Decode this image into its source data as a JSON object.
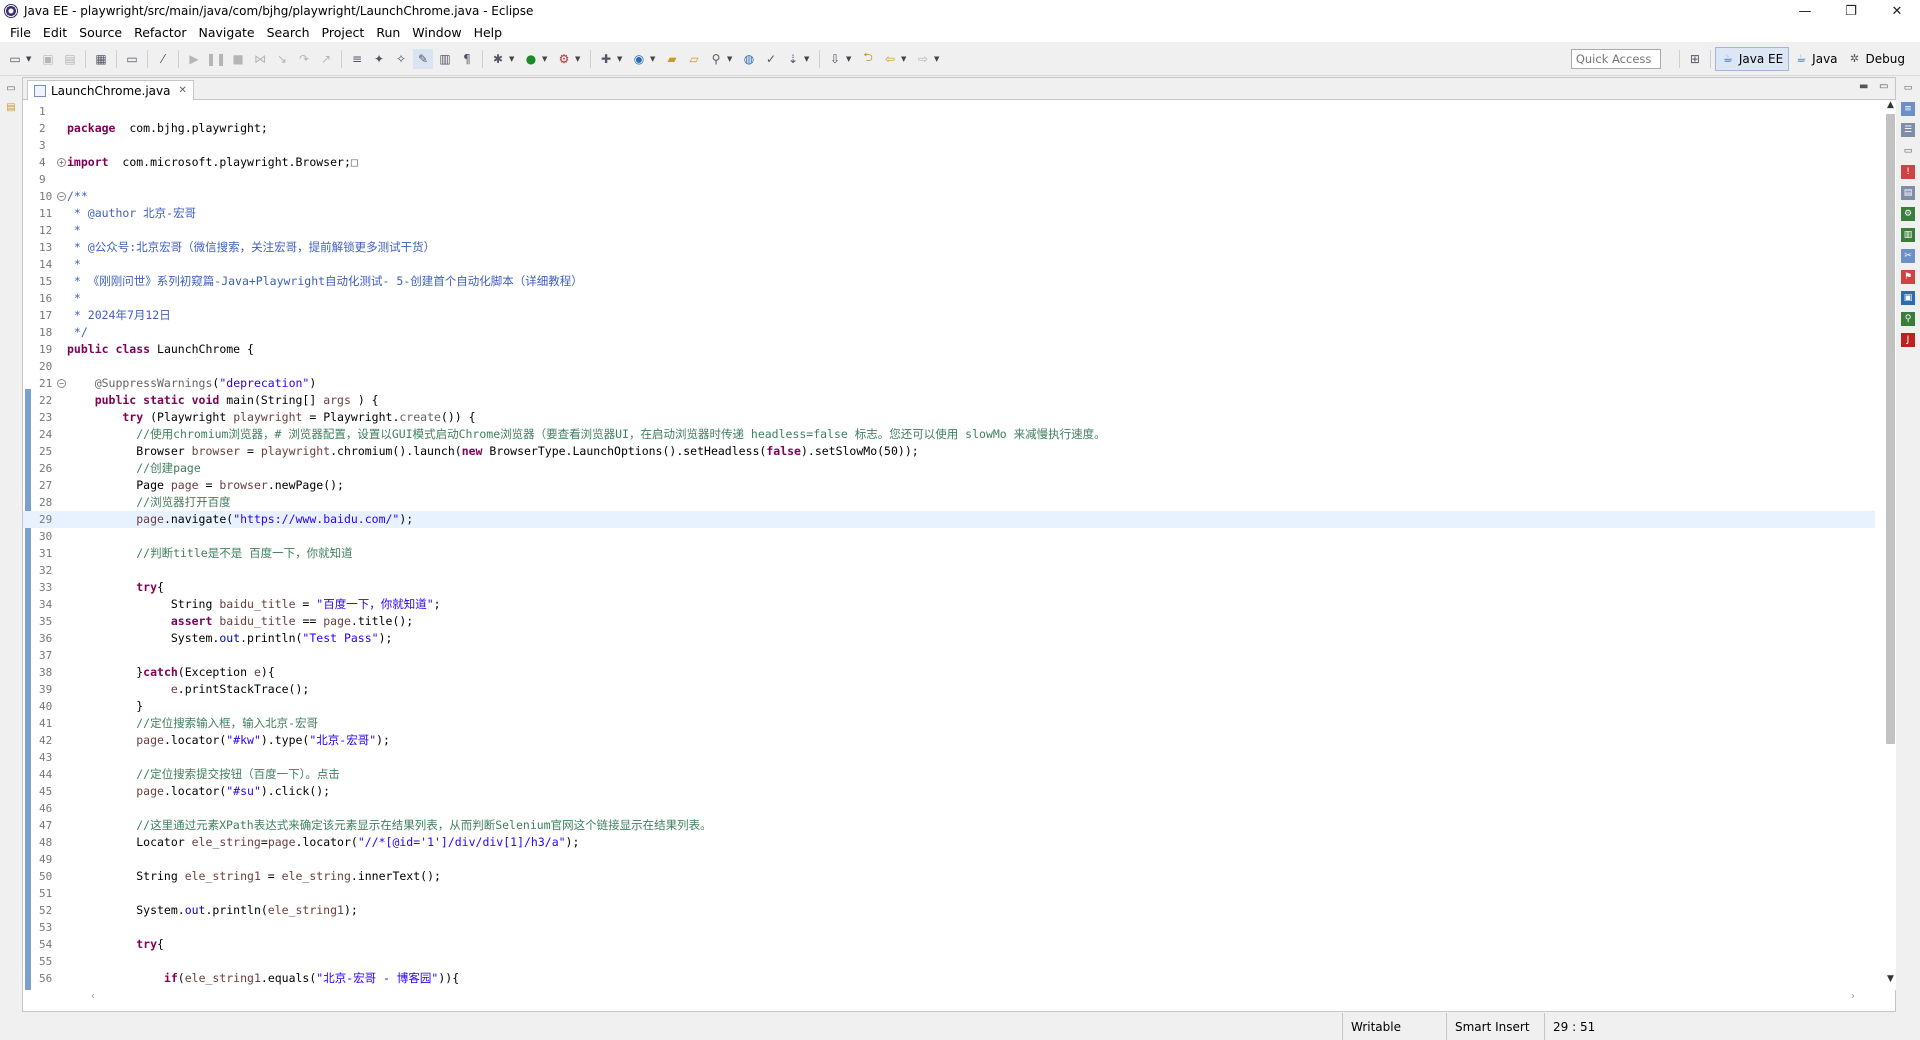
{
  "window": {
    "title": "Java EE - playwright/src/main/java/com/bjhg/playwright/LaunchChrome.java - Eclipse",
    "minimize": "—",
    "restore": "❐",
    "close": "✕"
  },
  "menu": [
    "File",
    "Edit",
    "Source",
    "Refactor",
    "Navigate",
    "Search",
    "Project",
    "Run",
    "Window",
    "Help"
  ],
  "toolbar": {
    "quick_access_placeholder": "Quick Access",
    "perspectives": [
      {
        "label": "Java EE",
        "active": true,
        "icon": "java-ee-perspective-icon"
      },
      {
        "label": "Java",
        "active": false,
        "icon": "java-perspective-icon"
      },
      {
        "label": "Debug",
        "active": false,
        "icon": "debug-perspective-icon"
      }
    ]
  },
  "editor": {
    "tab_label": "LaunchChrome.java",
    "tab_close": "✕",
    "current_line": 29
  },
  "status": {
    "writable": "Writable",
    "insert_mode": "Smart Insert",
    "position": "29 : 51"
  },
  "code": [
    {
      "n": "1",
      "t": []
    },
    {
      "n": "2",
      "t": [
        [
          "kw",
          "package"
        ],
        [
          "",
          "  com.bjhg.playwright;"
        ]
      ]
    },
    {
      "n": "3",
      "t": []
    },
    {
      "n": "4",
      "fold": "+",
      "t": [
        [
          "kw",
          "import"
        ],
        [
          "",
          "  com.microsoft.playwright.Browser;"
        ],
        [
          "an",
          "□"
        ]
      ]
    },
    {
      "n": "9",
      "t": []
    },
    {
      "n": "10",
      "fold": "−",
      "t": [
        [
          "jd",
          "/**"
        ]
      ]
    },
    {
      "n": "11",
      "t": [
        [
          "jd",
          " * @author 北京-宏哥"
        ]
      ]
    },
    {
      "n": "12",
      "t": [
        [
          "jd",
          " *"
        ]
      ]
    },
    {
      "n": "13",
      "t": [
        [
          "jd",
          " * @公众号:北京宏哥（微信搜索，关注宏哥，提前解锁更多测试干货）"
        ]
      ]
    },
    {
      "n": "14",
      "t": [
        [
          "jd",
          " *"
        ]
      ]
    },
    {
      "n": "15",
      "t": [
        [
          "jd",
          " * 《刚刚问世》系列初窥篇-Java+Playwright自动化测试- 5-创建首个自动化脚本（详细教程）"
        ]
      ]
    },
    {
      "n": "16",
      "t": [
        [
          "jd",
          " *"
        ]
      ]
    },
    {
      "n": "17",
      "t": [
        [
          "jd",
          " * 2024年7月12日"
        ]
      ]
    },
    {
      "n": "18",
      "t": [
        [
          "jd",
          " */"
        ]
      ]
    },
    {
      "n": "19",
      "t": [
        [
          "kw",
          "public class"
        ],
        [
          "",
          " LaunchChrome {"
        ]
      ]
    },
    {
      "n": "20",
      "t": []
    },
    {
      "n": "21",
      "fold": "−",
      "t": [
        [
          "an",
          "    @SuppressWarnings"
        ],
        [
          "",
          "("
        ],
        [
          "st",
          "\"deprecation\""
        ],
        [
          "",
          ")"
        ]
      ]
    },
    {
      "n": "22",
      "t": [
        [
          "kw",
          "    public static void"
        ],
        [
          "",
          " main(String[] "
        ],
        [
          "var",
          "args"
        ],
        [
          "",
          " ) {"
        ]
      ]
    },
    {
      "n": "23",
      "t": [
        [
          "kw",
          "        try"
        ],
        [
          "",
          " (Playwright "
        ],
        [
          "var",
          "playwright"
        ],
        [
          "",
          " = Playwright."
        ],
        [
          "an",
          "create"
        ],
        [
          "",
          "()) {"
        ]
      ]
    },
    {
      "n": "24",
      "t": [
        [
          "cm",
          "          //使用chromium浏览器，# 浏览器配置，设置以GUI模式启动Chrome浏览器（要查看浏览器UI，在启动浏览器时传递 headless=false 标志。您还可以使用 slowMo 来减慢执行速度。"
        ]
      ]
    },
    {
      "n": "25",
      "t": [
        [
          "",
          "          Browser "
        ],
        [
          "var",
          "browser"
        ],
        [
          "",
          " = "
        ],
        [
          "var",
          "playwright"
        ],
        [
          "",
          ".chromium().launch("
        ],
        [
          "kw",
          "new"
        ],
        [
          "",
          " BrowserType.LaunchOptions().setHeadless("
        ],
        [
          "kw",
          "false"
        ],
        [
          "",
          ").setSlowMo(50));"
        ]
      ]
    },
    {
      "n": "26",
      "t": [
        [
          "cm",
          "          //创建page"
        ]
      ]
    },
    {
      "n": "27",
      "t": [
        [
          "",
          "          Page "
        ],
        [
          "var",
          "page"
        ],
        [
          "",
          " = "
        ],
        [
          "var",
          "browser"
        ],
        [
          "",
          ".newPage();"
        ]
      ]
    },
    {
      "n": "28",
      "t": [
        [
          "cm",
          "          //浏览器打开百度"
        ]
      ]
    },
    {
      "n": "29",
      "t": [
        [
          "var",
          "          page"
        ],
        [
          "",
          ".navigate("
        ],
        [
          "st",
          "\"https://www.baidu.com/\""
        ],
        [
          "",
          ");"
        ]
      ]
    },
    {
      "n": "30",
      "t": []
    },
    {
      "n": "31",
      "t": [
        [
          "cm",
          "          //判断title是不是 百度一下，你就知道"
        ]
      ]
    },
    {
      "n": "32",
      "t": []
    },
    {
      "n": "33",
      "t": [
        [
          "kw",
          "          try"
        ],
        [
          "",
          "{"
        ]
      ]
    },
    {
      "n": "34",
      "t": [
        [
          "",
          "               String "
        ],
        [
          "var",
          "baidu_title"
        ],
        [
          "",
          " = "
        ],
        [
          "st",
          "\"百度一下，你就知道\""
        ],
        [
          "",
          ";"
        ]
      ]
    },
    {
      "n": "35",
      "t": [
        [
          "kw",
          "               assert"
        ],
        [
          "",
          " "
        ],
        [
          "var",
          "baidu_title"
        ],
        [
          "",
          " == "
        ],
        [
          "var",
          "page"
        ],
        [
          "",
          ".title();"
        ]
      ]
    },
    {
      "n": "36",
      "t": [
        [
          "",
          "               System."
        ],
        [
          "fld",
          "out"
        ],
        [
          "",
          ".println("
        ],
        [
          "st",
          "\"Test Pass\""
        ],
        [
          "",
          ");"
        ]
      ]
    },
    {
      "n": "37",
      "t": []
    },
    {
      "n": "38",
      "t": [
        [
          "",
          "          }"
        ],
        [
          "kw",
          "catch"
        ],
        [
          "",
          "(Exception "
        ],
        [
          "var",
          "e"
        ],
        [
          "",
          "){"
        ]
      ]
    },
    {
      "n": "39",
      "t": [
        [
          "var",
          "               e"
        ],
        [
          "",
          ".printStackTrace();"
        ]
      ]
    },
    {
      "n": "40",
      "t": [
        [
          "",
          "          }"
        ]
      ]
    },
    {
      "n": "41",
      "t": [
        [
          "cm",
          "          //定位搜索输入框，输入北京-宏哥"
        ]
      ]
    },
    {
      "n": "42",
      "t": [
        [
          "var",
          "          page"
        ],
        [
          "",
          ".locator("
        ],
        [
          "st",
          "\"#kw\""
        ],
        [
          "",
          ").type("
        ],
        [
          "st",
          "\"北京-宏哥\""
        ],
        [
          "",
          ");"
        ]
      ]
    },
    {
      "n": "43",
      "t": []
    },
    {
      "n": "44",
      "t": [
        [
          "cm",
          "          //定位搜索提交按钮（百度一下）。点击"
        ]
      ]
    },
    {
      "n": "45",
      "t": [
        [
          "var",
          "          page"
        ],
        [
          "",
          ".locator("
        ],
        [
          "st",
          "\"#su\""
        ],
        [
          "",
          ").click();"
        ]
      ]
    },
    {
      "n": "46",
      "t": []
    },
    {
      "n": "47",
      "t": [
        [
          "cm",
          "          //这里通过元素XPath表达式来确定该元素显示在结果列表，从而判断Selenium官网这个链接显示在结果列表。"
        ]
      ]
    },
    {
      "n": "48",
      "t": [
        [
          "",
          "          Locator "
        ],
        [
          "var",
          "ele_string"
        ],
        [
          "",
          "="
        ],
        [
          "var",
          "page"
        ],
        [
          "",
          ".locator("
        ],
        [
          "st",
          "\"//*[@id='1']/div/div[1]/h3/a\""
        ],
        [
          "",
          ");"
        ]
      ]
    },
    {
      "n": "49",
      "t": []
    },
    {
      "n": "50",
      "t": [
        [
          "",
          "          String "
        ],
        [
          "var",
          "ele_string1"
        ],
        [
          "",
          " = "
        ],
        [
          "var",
          "ele_string"
        ],
        [
          "",
          ".innerText();"
        ]
      ]
    },
    {
      "n": "51",
      "t": []
    },
    {
      "n": "52",
      "t": [
        [
          "",
          "          System."
        ],
        [
          "fld",
          "out"
        ],
        [
          "",
          ".println("
        ],
        [
          "var",
          "ele_string1"
        ],
        [
          "",
          ");"
        ]
      ]
    },
    {
      "n": "53",
      "t": []
    },
    {
      "n": "54",
      "t": [
        [
          "kw",
          "          try"
        ],
        [
          "",
          "{"
        ]
      ]
    },
    {
      "n": "55",
      "t": []
    },
    {
      "n": "56",
      "t": [
        [
          "kw",
          "              if"
        ],
        [
          "",
          "("
        ],
        [
          "var",
          "ele_string1"
        ],
        [
          "",
          ".equals("
        ],
        [
          "st",
          "\"北京-宏哥 - 博客园\""
        ],
        [
          "",
          "))"
        ],
        [
          "",
          "{"
        ]
      ]
    }
  ]
}
